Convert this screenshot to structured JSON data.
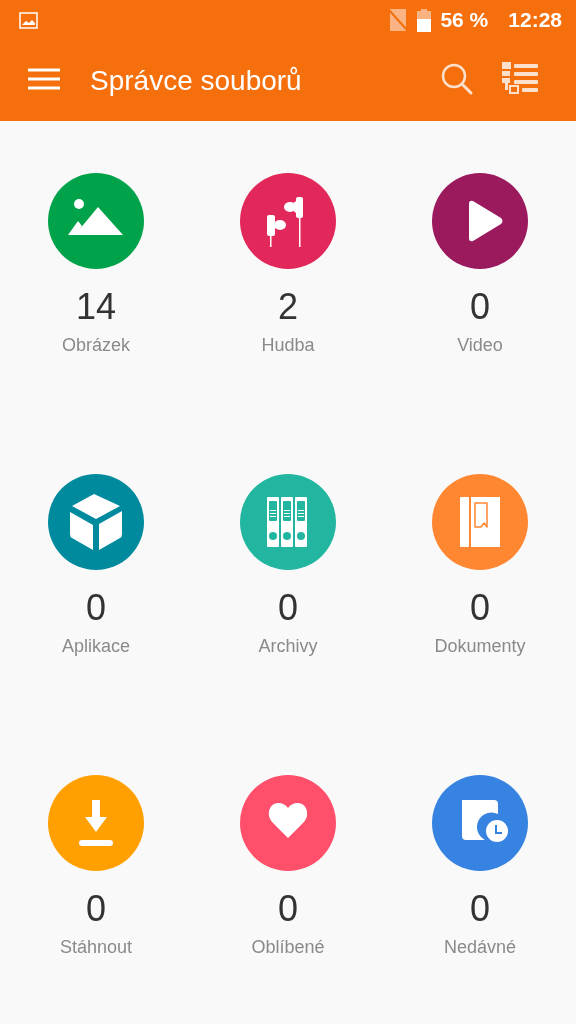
{
  "status_bar": {
    "battery_percent": "56 %",
    "time": "12:28"
  },
  "app_bar": {
    "title": "Správce souborů"
  },
  "categories": [
    {
      "kind": "image",
      "count": "14",
      "label": "Obrázek",
      "color": "#00a34a"
    },
    {
      "kind": "music",
      "count": "2",
      "label": "Hudba",
      "color": "#e2275a"
    },
    {
      "kind": "video",
      "count": "0",
      "label": "Video",
      "color": "#9b195d"
    },
    {
      "kind": "apps",
      "count": "0",
      "label": "Aplikace",
      "color": "#008a9e"
    },
    {
      "kind": "archives",
      "count": "0",
      "label": "Archivy",
      "color": "#22b6a0"
    },
    {
      "kind": "documents",
      "count": "0",
      "label": "Dokumenty",
      "color": "#ff8731"
    },
    {
      "kind": "download",
      "count": "0",
      "label": "Stáhnout",
      "color": "#ff9f00"
    },
    {
      "kind": "favorites",
      "count": "0",
      "label": "Oblíbené",
      "color": "#ff4f6b"
    },
    {
      "kind": "recent",
      "count": "0",
      "label": "Nedávné",
      "color": "#3783e2"
    }
  ]
}
